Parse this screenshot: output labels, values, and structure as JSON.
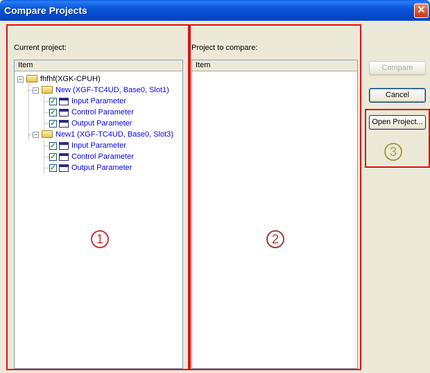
{
  "window": {
    "title": "Compare Projects"
  },
  "current_project": {
    "label": "Current project:",
    "column_header": "Item",
    "root": {
      "label": "fhfhf(XGK-CPUH)",
      "modules": [
        {
          "label": "New (XGF-TC4UD, Base0, Slot1)",
          "children": [
            "Input Parameter",
            "Control Parameter",
            "Output Parameter"
          ]
        },
        {
          "label": "New1 (XGF-TC4UD, Base0, Slot3)",
          "children": [
            "Input Parameter",
            "Control Parameter",
            "Output Parameter"
          ]
        }
      ]
    }
  },
  "project_to_compare": {
    "label": "Project to compare:",
    "column_header": "Item"
  },
  "buttons": {
    "compare": "Compare",
    "cancel": "Cancel",
    "open_project": "Open Project..."
  },
  "markers": {
    "one": "1",
    "two": "2",
    "three": "3"
  },
  "colors": {
    "highlight_box": "#e01010",
    "marker_1": "#d43030",
    "marker_2": "#a83838",
    "marker_3": "#a8a040",
    "link_text": "#0000ff"
  }
}
